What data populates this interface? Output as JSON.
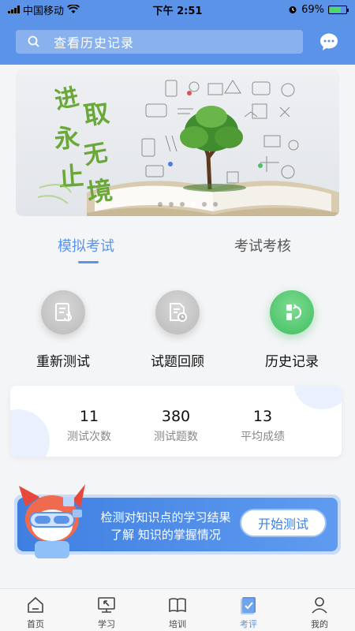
{
  "status_bar": {
    "carrier": "中国移动",
    "time": "下午 2:51",
    "battery": "69%",
    "battery_level": 0.69
  },
  "header": {
    "search_placeholder": "查看历史记录",
    "icons": [
      "search-icon",
      "chat-icon"
    ]
  },
  "banner": {
    "calligraphy": "进取永无止境",
    "slides": 6,
    "active_slide": 4
  },
  "tabs": [
    {
      "label": "模拟考试",
      "active": true
    },
    {
      "label": "考试考核",
      "active": false
    }
  ],
  "actions": [
    {
      "label": "重新测试",
      "icon": "retest-icon"
    },
    {
      "label": "试题回顾",
      "icon": "review-icon"
    },
    {
      "label": "历史记录",
      "icon": "history-icon"
    }
  ],
  "stats": [
    {
      "value": "11",
      "label": "测试次数"
    },
    {
      "value": "380",
      "label": "测试题数"
    },
    {
      "value": "13",
      "label": "平均成绩"
    }
  ],
  "promo": {
    "line1": "检测对知识点的学习结果",
    "line2": "了解 知识的掌握情况",
    "button": "开始测试"
  },
  "bottom_nav": [
    {
      "label": "首页",
      "icon": "home-icon",
      "active": false
    },
    {
      "label": "学习",
      "icon": "study-icon",
      "active": false
    },
    {
      "label": "培训",
      "icon": "book-icon",
      "active": false
    },
    {
      "label": "考评",
      "icon": "exam-icon",
      "active": true
    },
    {
      "label": "我的",
      "icon": "profile-icon",
      "active": false
    }
  ],
  "colors": {
    "primary": "#5b93e8",
    "success": "#3fbd5e",
    "inactive_icon": "#b9b9b9"
  }
}
